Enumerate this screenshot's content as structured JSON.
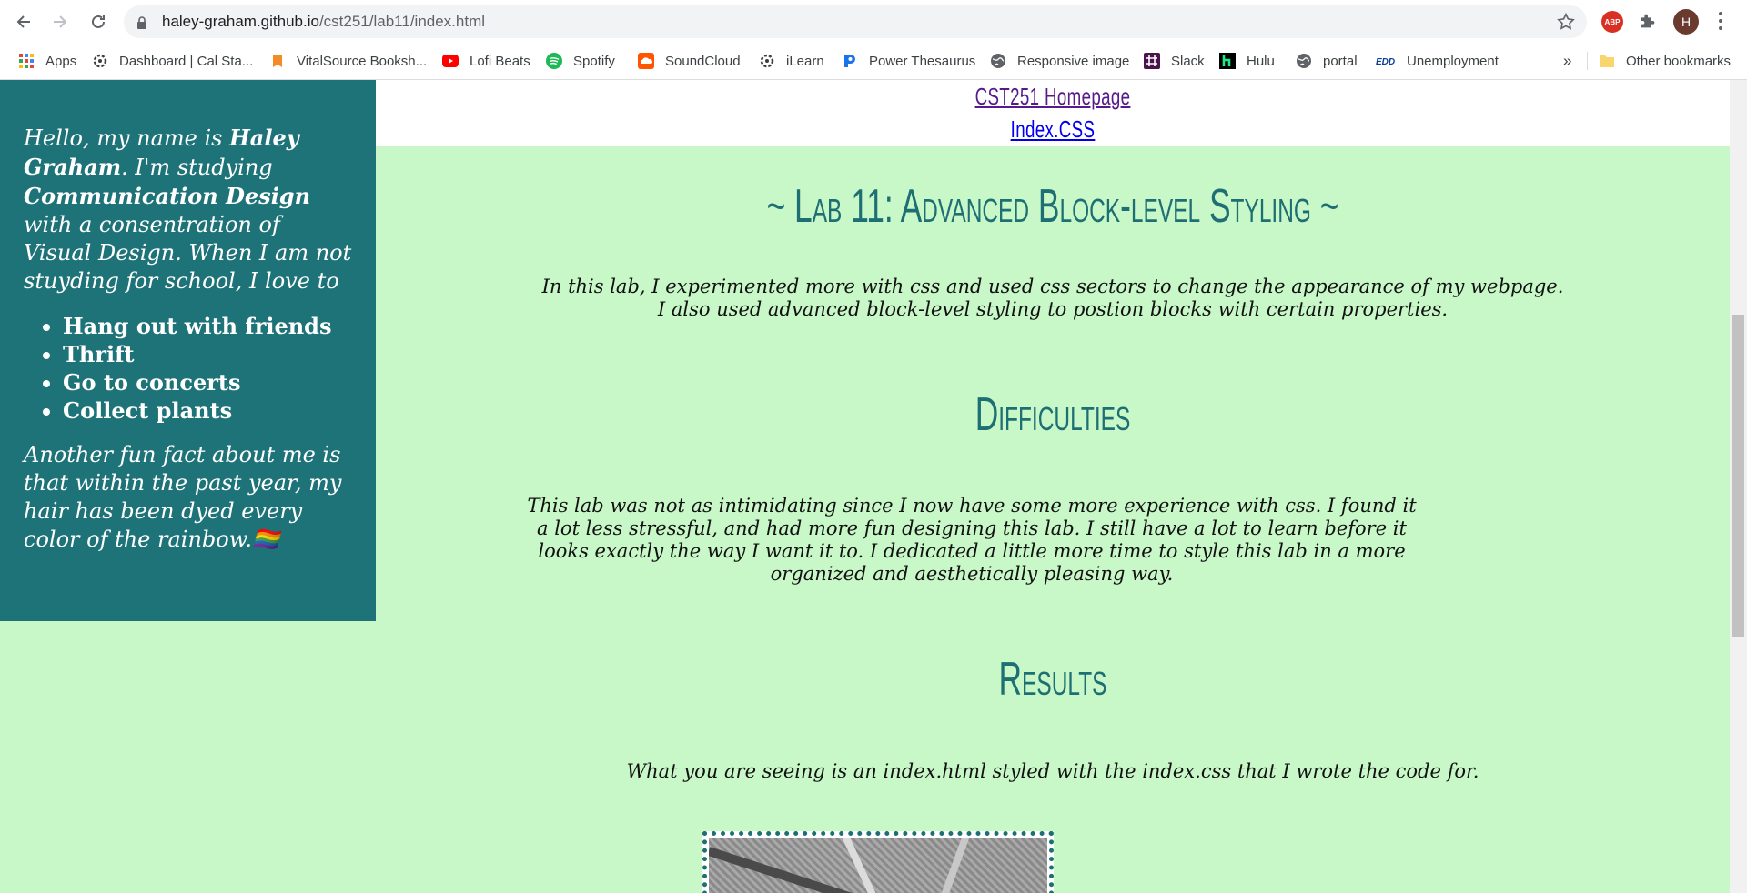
{
  "browser": {
    "url_host": "haley-graham.github.io",
    "url_path": "/cst251/lab11/index.html",
    "abp_label": "ABP",
    "avatar_letter": "H",
    "bookmarks": [
      {
        "label": "Apps",
        "icon": "apps-grid-icon"
      },
      {
        "label": "Dashboard | Cal Sta...",
        "icon": "gear-icon"
      },
      {
        "label": "VitalSource Booksh...",
        "icon": "vitalsource-icon"
      },
      {
        "label": "Lofi Beats",
        "icon": "youtube-icon"
      },
      {
        "label": "Spotify",
        "icon": "spotify-icon"
      },
      {
        "label": "SoundCloud",
        "icon": "soundcloud-icon"
      },
      {
        "label": "iLearn",
        "icon": "gear-icon"
      },
      {
        "label": "Power Thesaurus",
        "icon": "power-thesaurus-icon"
      },
      {
        "label": "Responsive image",
        "icon": "globe-icon"
      },
      {
        "label": "Slack",
        "icon": "slack-icon"
      },
      {
        "label": "Hulu",
        "icon": "hulu-icon"
      },
      {
        "label": "portal",
        "icon": "globe-icon"
      },
      {
        "label": "Unemployment",
        "icon": "edd-icon"
      }
    ],
    "overflow_label": "»",
    "other_bookmarks": "Other bookmarks"
  },
  "page": {
    "top_links": {
      "home": "CST251 Homepage",
      "css": "Index.CSS"
    },
    "sidebar": {
      "intro_1": "Hello, my name is ",
      "name": "Haley Graham",
      "intro_2": ". I'm studying ",
      "major": "Communication Design",
      "intro_3": " with a consentration of Visual Design. When I am not stuyding for school, I love to",
      "hobbies": [
        "Hang out with friends",
        "Thrift",
        "Go to concerts",
        "Collect plants"
      ],
      "fact": "Another fun fact about me is that within the past year, my hair has been dyed every color of the rainbow.",
      "flag_emoji": "🏳️‍🌈"
    },
    "main": {
      "lab_title": "~ Lab 11: Advanced Block-level Styling ~",
      "intro_text": "In this lab, I experimented more with css and used css sectors to change the appearance of my webpage.",
      "intro_text_2": "I also used advanced block-level styling to postion blocks with certain properties.",
      "difficulties_heading": "Difficulties",
      "difficulties_text": "This lab was not as intimidating since I now have some more experience with css. I found it a lot less stressful, and had more fun designing this lab. I still have a lot to learn before it looks exactly the way I want it to. I dedicated a little more time to style this lab in a more organized and aesthetically pleasing way.",
      "results_heading": "Results",
      "results_text": "What you are seeing is an index.html styled with the index.css that I wrote the code for."
    },
    "colors": {
      "background": "#c8f7c8",
      "sidebar": "#1e7378",
      "heading": "#1e6f73"
    }
  }
}
